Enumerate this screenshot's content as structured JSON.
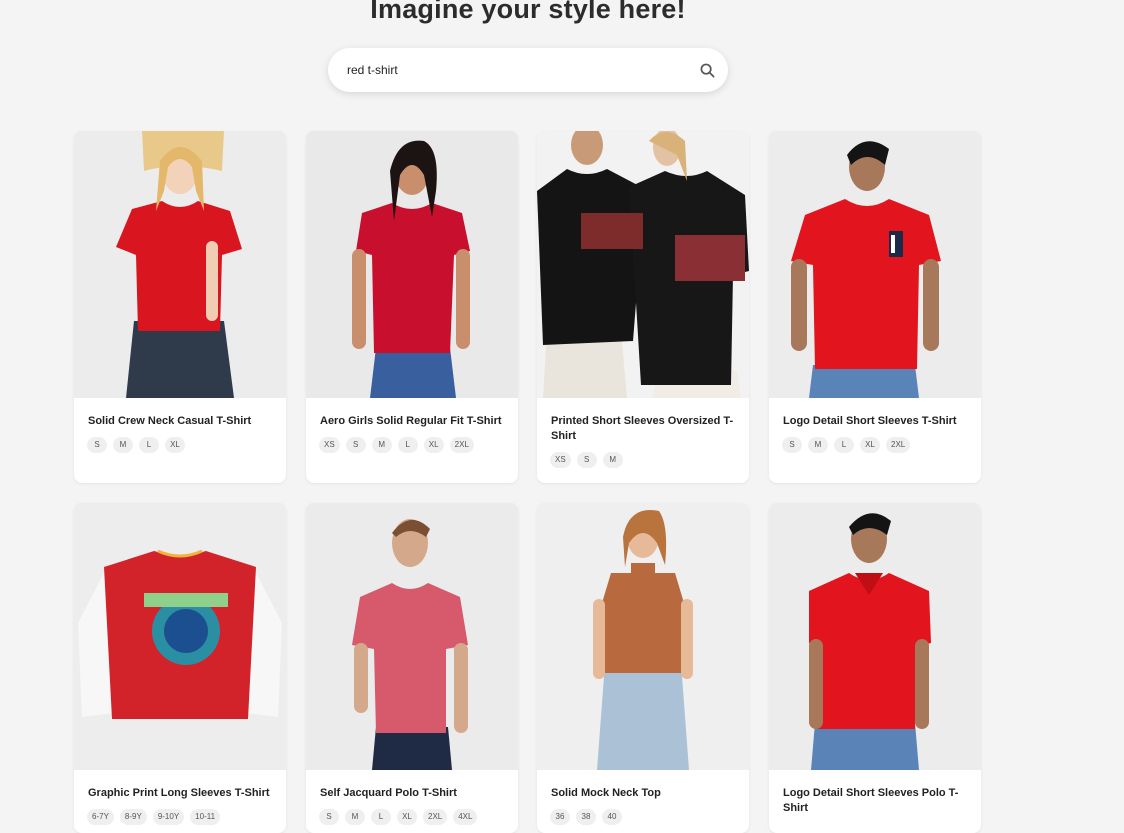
{
  "header": {
    "title": "Imagine your style here!"
  },
  "search": {
    "value": "red t-shirt",
    "icon": "search-icon"
  },
  "products": [
    {
      "name": "Solid Crew Neck Casual T-Shirt",
      "sizes": [
        "S",
        "M",
        "L",
        "XL"
      ]
    },
    {
      "name": "Aero Girls Solid Regular Fit T-Shirt",
      "sizes": [
        "XS",
        "S",
        "M",
        "L",
        "XL",
        "2XL"
      ]
    },
    {
      "name": "Printed Short Sleeves Oversized T-Shirt",
      "sizes": [
        "XS",
        "S",
        "M"
      ]
    },
    {
      "name": "Logo Detail Short Sleeves T-Shirt",
      "sizes": [
        "S",
        "M",
        "L",
        "XL",
        "2XL"
      ]
    },
    {
      "name": "Graphic Print Long Sleeves T-Shirt",
      "sizes": [
        "6-7Y",
        "8-9Y",
        "9-10Y",
        "10-11"
      ]
    },
    {
      "name": "Self Jacquard Polo T-Shirt",
      "sizes": [
        "S",
        "M",
        "L",
        "XL",
        "2XL",
        "4XL"
      ]
    },
    {
      "name": "Solid Mock Neck Top",
      "sizes": [
        "36",
        "38",
        "40"
      ]
    },
    {
      "name": "Logo Detail Short Sleeves Polo T-Shirt",
      "sizes": []
    }
  ],
  "colors": {
    "background": "#f4f4f4",
    "card": "#ffffff",
    "chip": "#efefef",
    "red_shirt": "#d9161f"
  }
}
